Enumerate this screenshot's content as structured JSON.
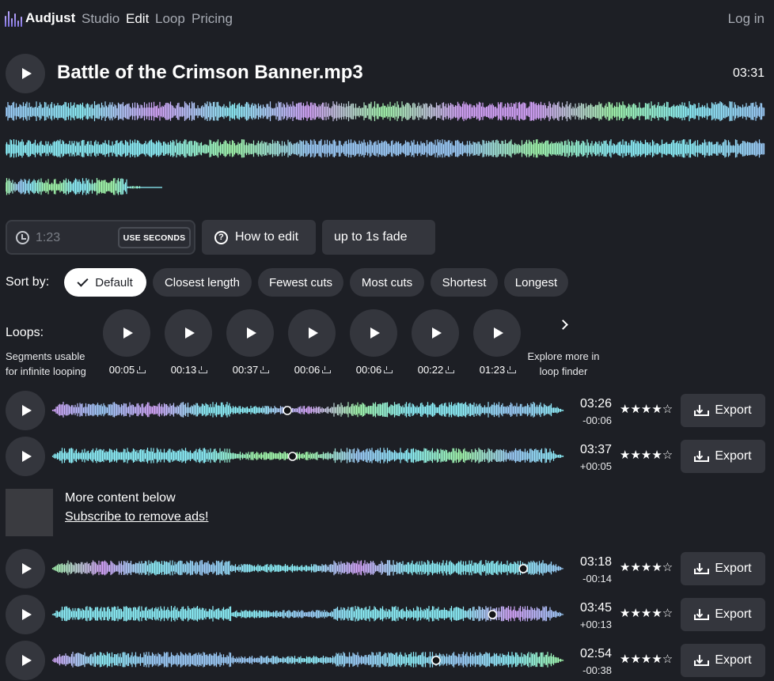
{
  "nav": {
    "brand": "Audjust",
    "links": [
      "Studio",
      "Edit",
      "Loop",
      "Pricing"
    ],
    "active": "Edit",
    "login": "Log in"
  },
  "track": {
    "title": "Battle of the Crimson Banner.mp3",
    "duration": "03:31"
  },
  "controls": {
    "time_placeholder": "1:23",
    "use_seconds": "USE SECONDS",
    "how_to_edit": "How to edit",
    "fade": "up to 1s fade"
  },
  "sort": {
    "label": "Sort by:",
    "options": [
      "Default",
      "Closest length",
      "Fewest cuts",
      "Most cuts",
      "Shortest",
      "Longest"
    ],
    "selected": "Default"
  },
  "loops": {
    "label": "Loops:",
    "description_line1": "Segments usable",
    "description_line2": "for infinite looping",
    "items": [
      "00:05",
      "00:13",
      "00:37",
      "00:06",
      "00:06",
      "00:22",
      "01:23"
    ],
    "explore_line1": "Explore more in",
    "explore_line2": "loop finder"
  },
  "results": [
    {
      "time": "03:26",
      "diff": "-00:06",
      "stars": "★★★★☆",
      "rating": 4,
      "cut_fraction": 0.46
    },
    {
      "time": "03:37",
      "diff": "+00:05",
      "stars": "★★★★☆",
      "rating": 4,
      "cut_fraction": 0.47
    },
    {
      "time": "03:18",
      "diff": "-00:14",
      "stars": "★★★★☆",
      "rating": 4,
      "cut_fraction": 0.92
    },
    {
      "time": "03:45",
      "diff": "+00:13",
      "stars": "★★★★☆",
      "rating": 4,
      "cut_fraction": 0.86
    },
    {
      "time": "02:54",
      "diff": "-00:38",
      "stars": "★★★★☆",
      "rating": 4,
      "cut_fraction": 0.75
    }
  ],
  "export_label": "Export",
  "ad": {
    "text": "More content below",
    "link": "Subscribe to remove ads!"
  },
  "colors": {
    "background": "#1d1f25",
    "button": "#34363d",
    "wave_cyan": "#8ff5ff",
    "wave_purple": "#d9a6ff",
    "wave_green": "#a6ffb0"
  }
}
